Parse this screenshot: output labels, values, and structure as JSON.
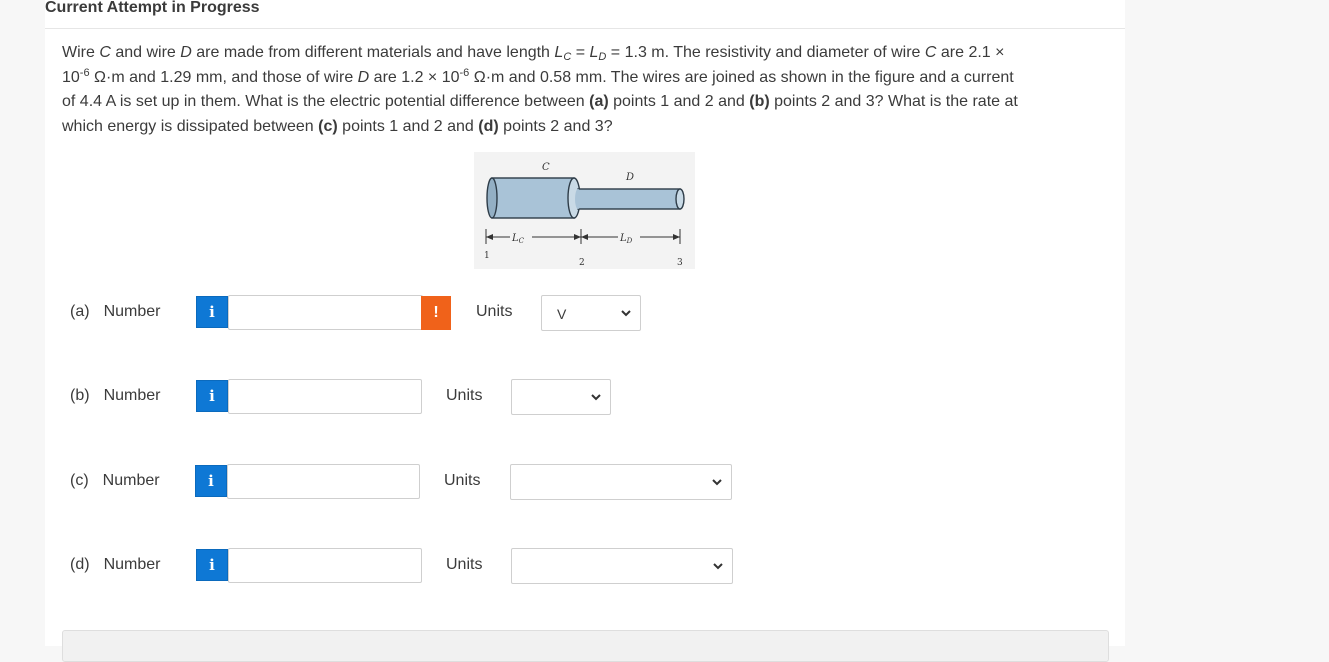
{
  "header": {
    "title": "Current Attempt in Progress"
  },
  "question": {
    "line1_a": "Wire ",
    "wire_c": "C",
    "line1_b": " and wire ",
    "wire_d": "D",
    "line1_c": " are made from different materials and have length ",
    "L": "L",
    "sub_c": "C",
    "eq1": " = ",
    "sub_d": "D",
    "line1_d": " = 1.3 m. The resistivity and diameter of wire ",
    "line1_e": " are 2.1 ×",
    "line2_a": "10",
    "exp": "-6",
    "line2_b": " Ω·m and 1.29 mm, and those of wire ",
    "line2_c": " are 1.2 × 10",
    "line2_d": " Ω·m and 0.58 mm. The wires are joined as shown in the figure and a current",
    "line3_a": "of 4.4 A is set up in them. What is the electric potential difference between ",
    "pa": "(a)",
    "line3_b": " points 1 and 2 and ",
    "pb": "(b)",
    "line3_c": " points 2 and 3? What is the rate at",
    "line4_a": "which energy is dissipated between ",
    "pc": "(c)",
    "line4_b": " points 1 and 2 and ",
    "pd": "(d)",
    "line4_c": " points 2 and 3?"
  },
  "figure": {
    "label_c": "C",
    "label_d": "D",
    "label_lc": "L",
    "label_lc_sub": "C",
    "label_ld": "L",
    "label_ld_sub": "D",
    "point1": "1",
    "point2": "2",
    "point3": "3"
  },
  "rows": [
    {
      "part": "(a)",
      "label": "Number",
      "info": "i",
      "value": "",
      "warn": "!",
      "units_label": "Units",
      "units_value": "V"
    },
    {
      "part": "(b)",
      "label": "Number",
      "info": "i",
      "value": "",
      "units_label": "Units",
      "units_value": ""
    },
    {
      "part": "(c)",
      "label": "Number",
      "info": "i",
      "value": "",
      "units_label": "Units",
      "units_value": ""
    },
    {
      "part": "(d)",
      "label": "Number",
      "info": "i",
      "value": "",
      "units_label": "Units",
      "units_value": ""
    }
  ],
  "colors": {
    "info_blue": "#0e78d5",
    "warn_orange": "#f0621a",
    "wire_fill": "#a9c3d7"
  }
}
